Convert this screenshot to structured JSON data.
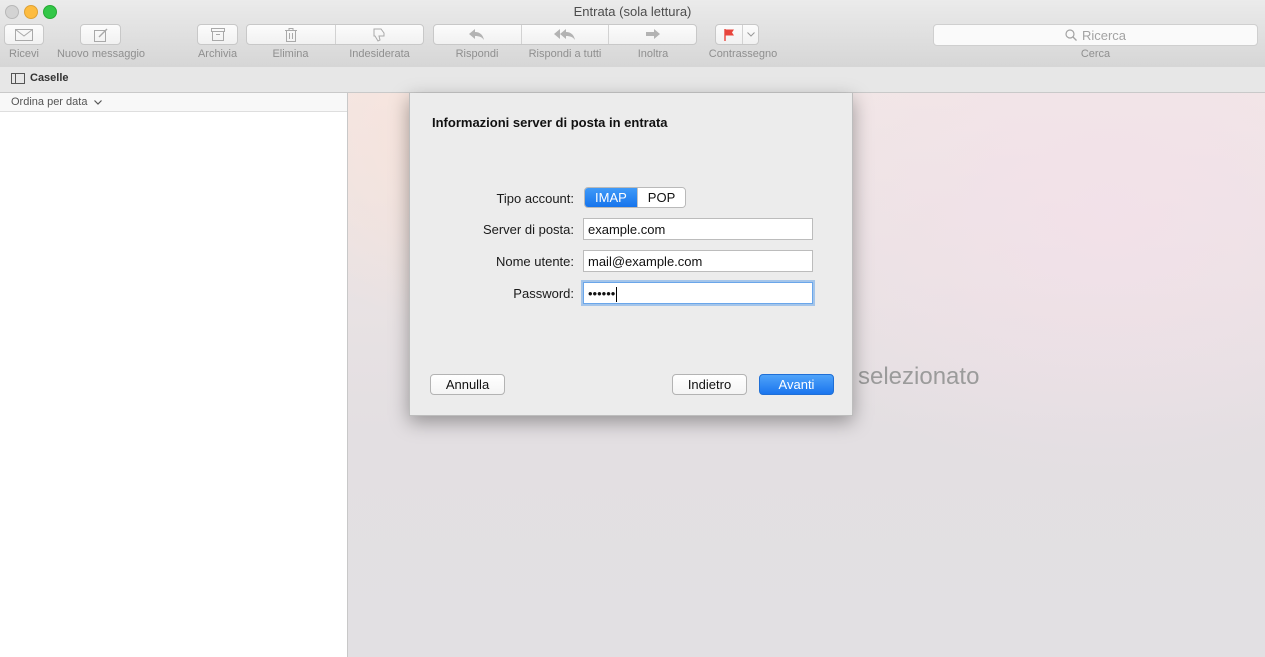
{
  "window": {
    "title": "Entrata (sola lettura)"
  },
  "toolbar": {
    "get_mail": "Ricevi",
    "new_message": "Nuovo messaggio",
    "archive": "Archivia",
    "delete": "Elimina",
    "junk": "Indesiderata",
    "reply": "Rispondi",
    "reply_all": "Rispondi a tutti",
    "forward": "Inoltra",
    "flag": "Contrassegno",
    "search_placeholder": "Ricerca",
    "search_label": "Cerca",
    "flag_color": "#e8453c"
  },
  "mailboxes_bar": {
    "label": "Caselle"
  },
  "list": {
    "sort_label": "Ordina per data"
  },
  "viewer": {
    "no_message_text": "selezionato"
  },
  "sheet": {
    "title": "Informazioni server di posta in entrata",
    "account_type_label": "Tipo account:",
    "account_types": [
      "IMAP",
      "POP"
    ],
    "selected_account_type": "IMAP",
    "mail_server_label": "Server di posta:",
    "mail_server_value": "example.com",
    "username_label": "Nome utente:",
    "username_value": "mail@example.com",
    "password_label": "Password:",
    "password_value": "••••••",
    "cancel_label": "Annulla",
    "back_label": "Indietro",
    "next_label": "Avanti"
  }
}
